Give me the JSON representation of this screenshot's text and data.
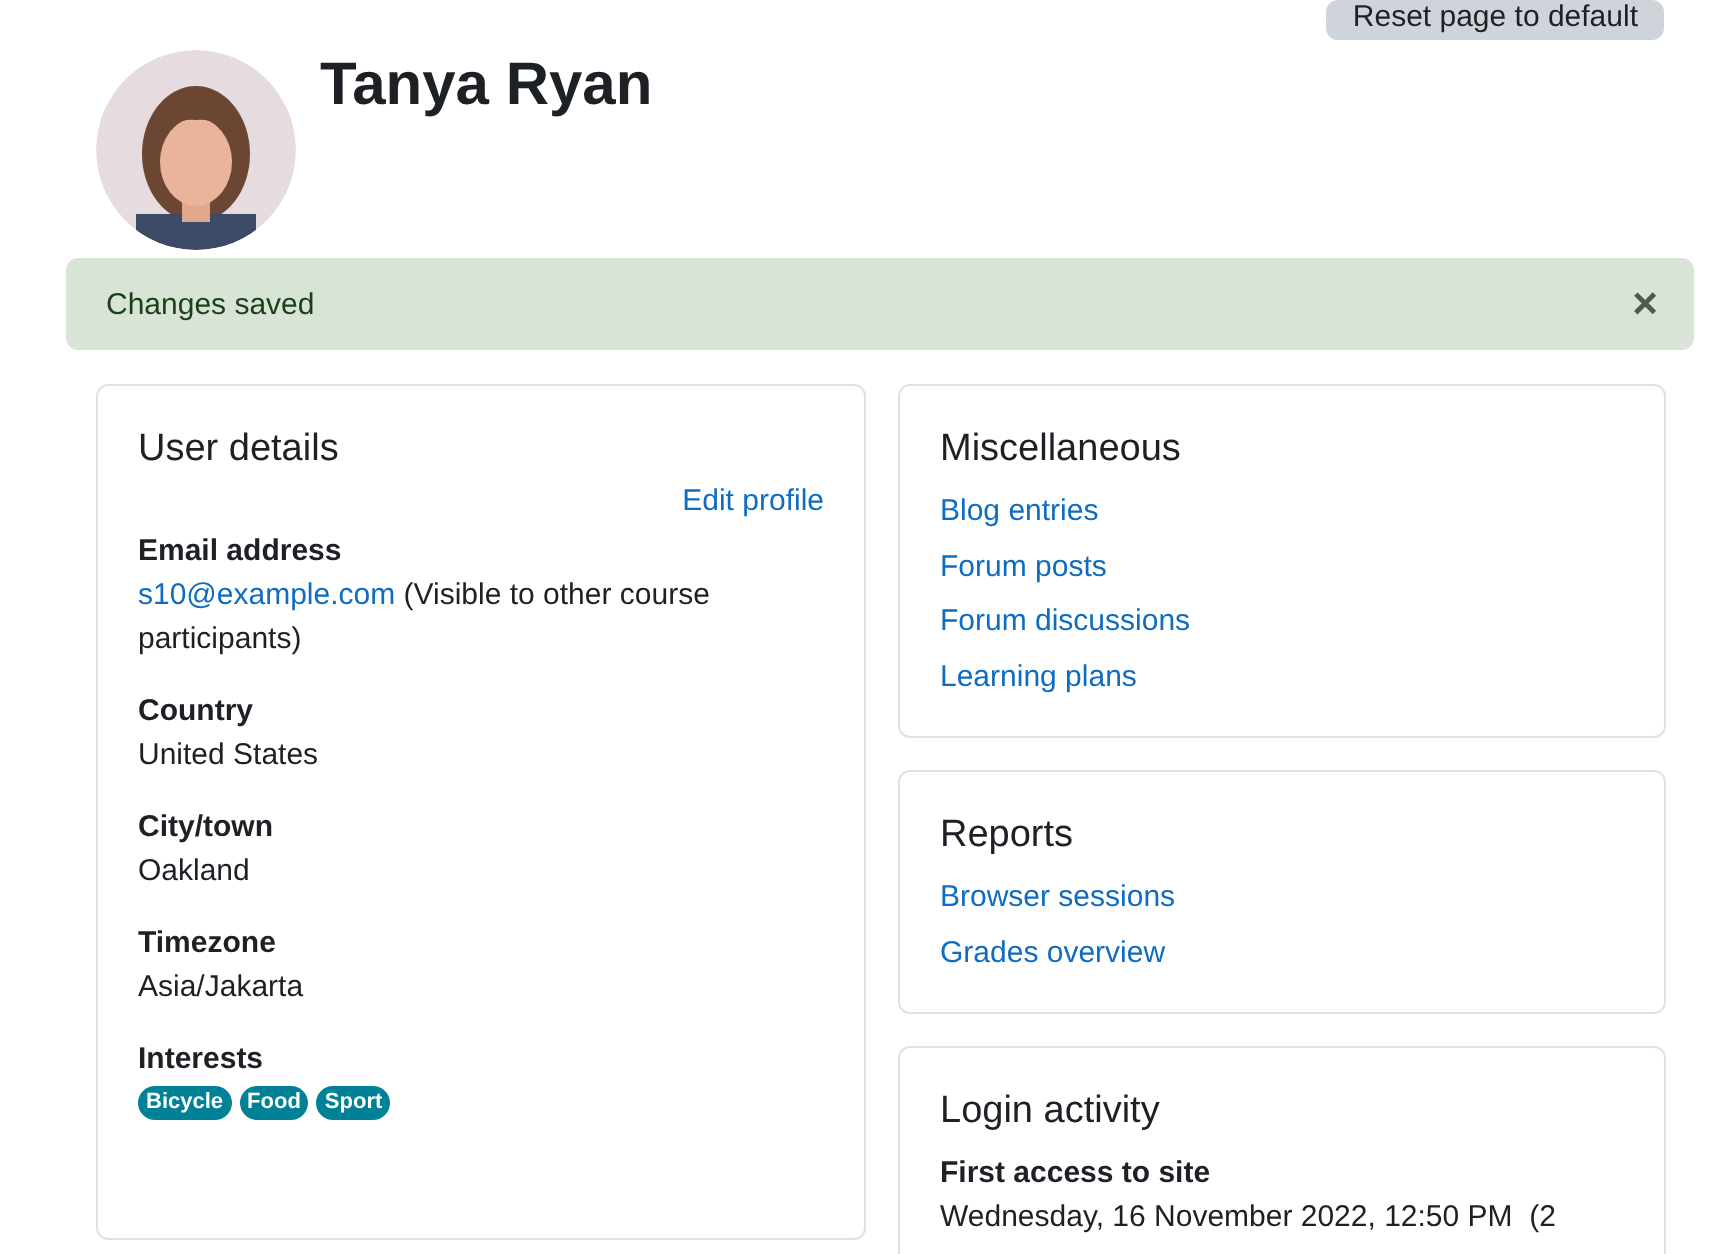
{
  "reset_button": "Reset page to default",
  "profile": {
    "name": "Tanya Ryan"
  },
  "alert": {
    "message": "Changes saved",
    "close": "×"
  },
  "user_details": {
    "title": "User details",
    "edit_link": "Edit profile",
    "fields": [
      {
        "label": "Email address",
        "link": "s10@example.com",
        "value": " (Visible to other course participants)"
      },
      {
        "label": "Country",
        "value": "United States"
      },
      {
        "label": "City/town",
        "value": "Oakland"
      },
      {
        "label": "Timezone",
        "value": "Asia/Jakarta"
      },
      {
        "label": "Interests",
        "tags": [
          "Bicycle",
          "Food",
          "Sport"
        ]
      }
    ]
  },
  "miscellaneous": {
    "title": "Miscellaneous",
    "links": [
      "Blog entries",
      "Forum posts",
      "Forum discussions",
      "Learning plans"
    ]
  },
  "reports": {
    "title": "Reports",
    "links": [
      "Browser sessions",
      "Grades overview"
    ]
  },
  "login_activity": {
    "title": "Login activity",
    "fields": [
      {
        "label": "First access to site",
        "value": "Wednesday, 16 November 2022, 12:50 PM  (2"
      }
    ]
  }
}
